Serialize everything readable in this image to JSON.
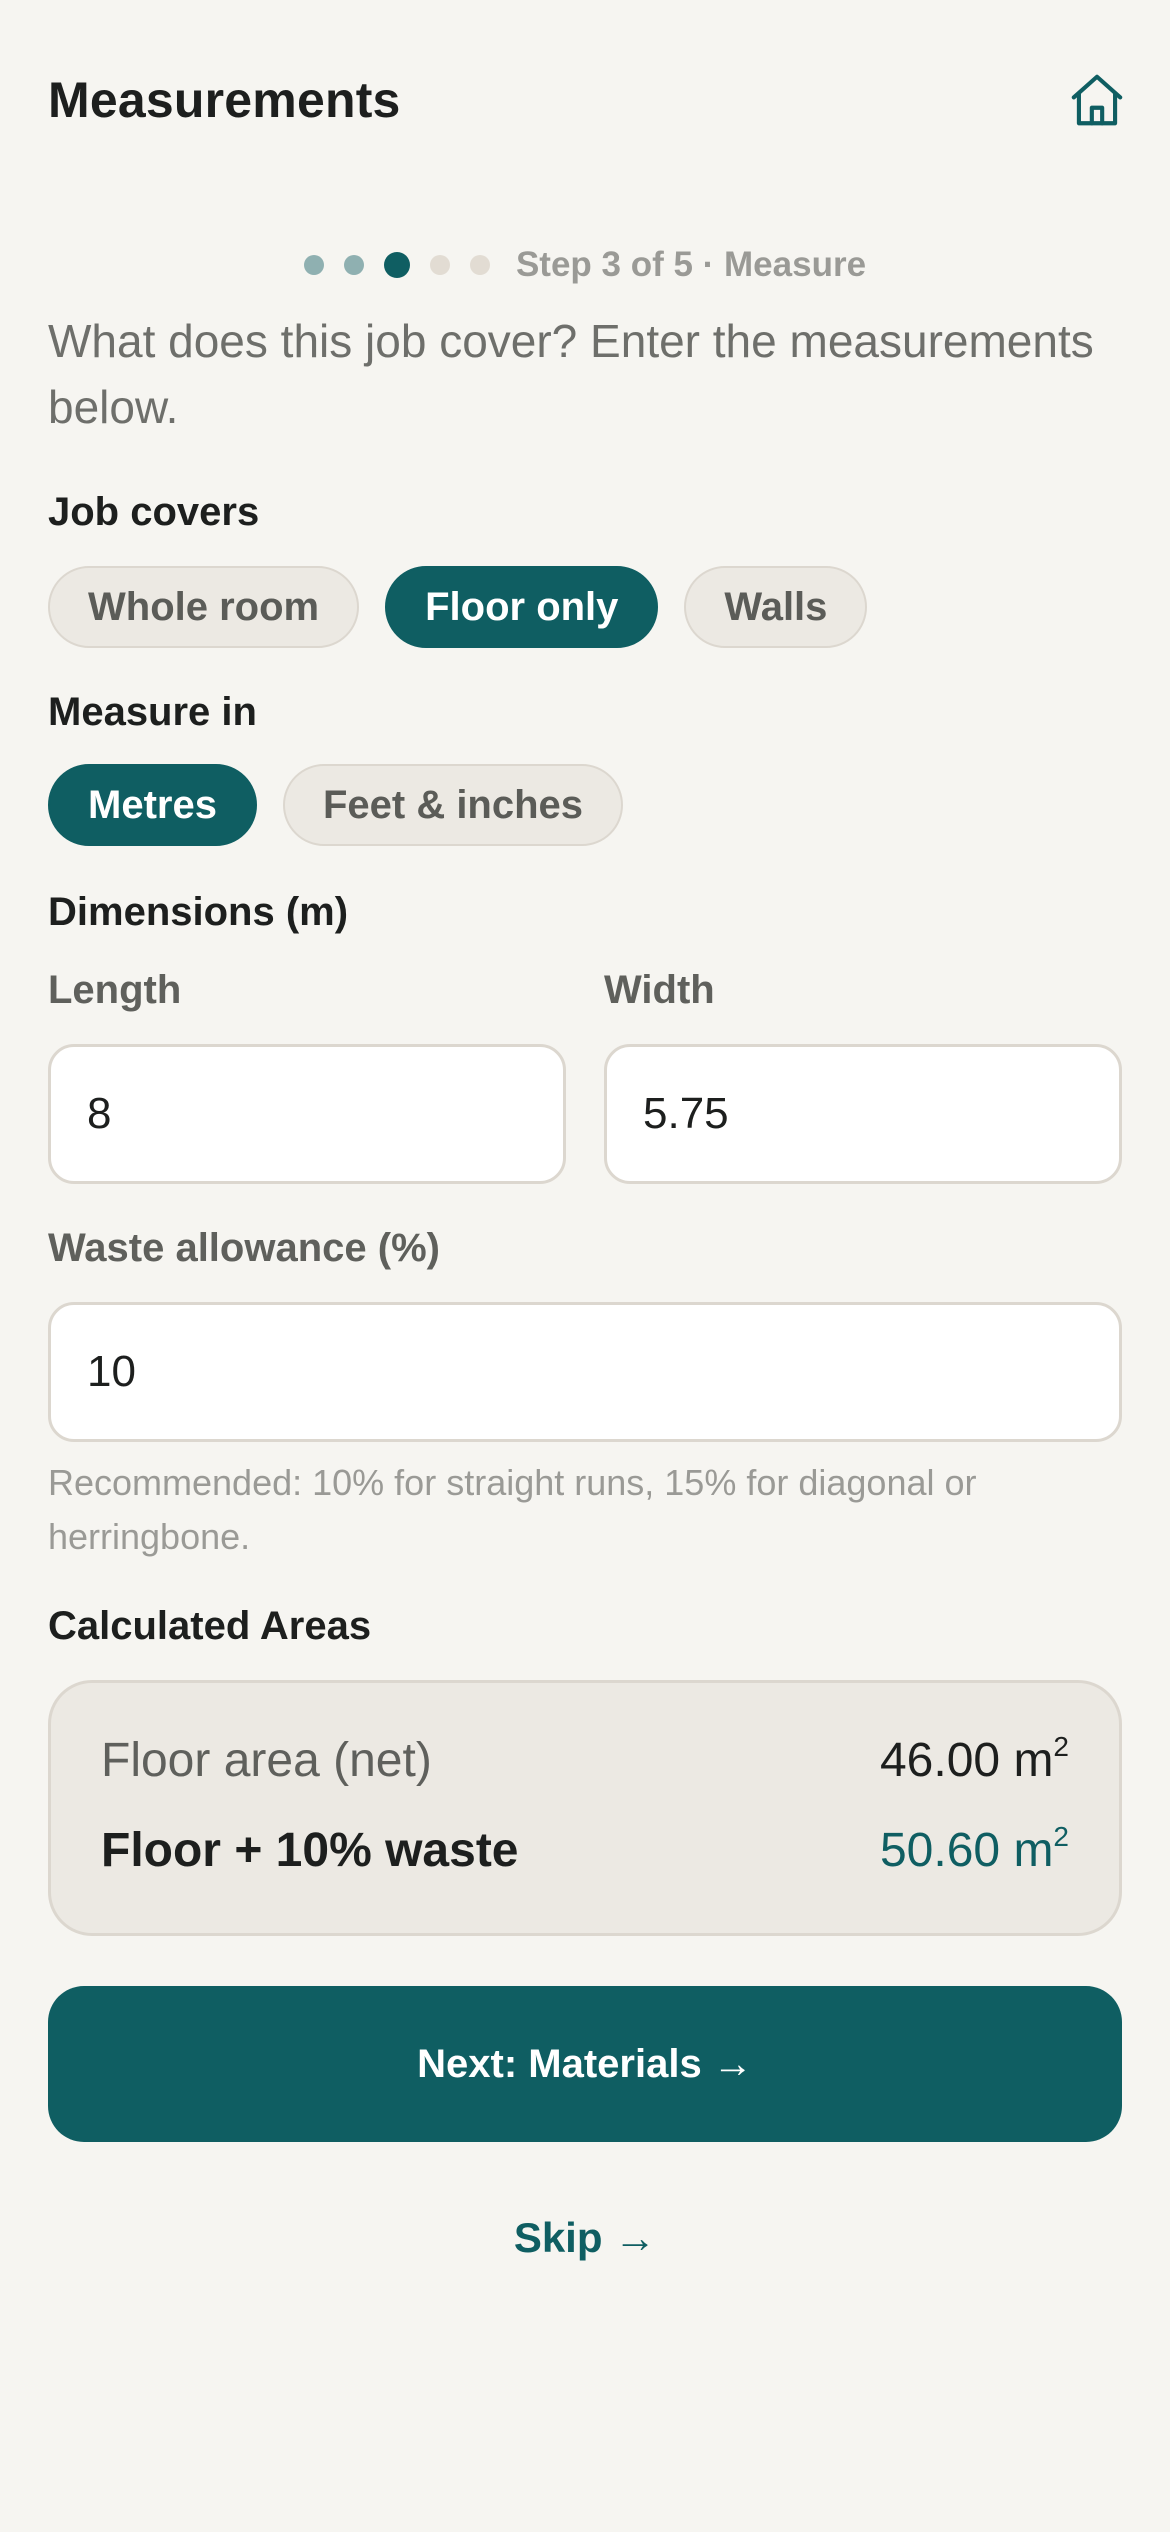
{
  "header": {
    "title": "Measurements",
    "home_icon": "home-icon"
  },
  "stepper": {
    "current": 3,
    "total": 5,
    "label": "Step 3 of 5 · Measure"
  },
  "intro": "What does this job cover? Enter the measurements below.",
  "job_covers": {
    "label": "Job covers",
    "options": [
      "Whole room",
      "Floor only",
      "Walls"
    ],
    "selected": "Floor only"
  },
  "measure_in": {
    "label": "Measure in",
    "options": [
      "Metres",
      "Feet & inches"
    ],
    "selected": "Metres"
  },
  "dimensions": {
    "label": "Dimensions (m)",
    "length_label": "Length",
    "length_value": "8",
    "width_label": "Width",
    "width_value": "5.75"
  },
  "waste": {
    "label": "Waste allowance (%)",
    "value": "10",
    "hint": "Recommended: 10% for straight runs, 15% for diagonal or herringbone."
  },
  "areas": {
    "label": "Calculated Areas",
    "net_label": "Floor area (net)",
    "net_value": "46.00 m",
    "net_unit_sup": "2",
    "waste_label": "Floor + 10% waste",
    "waste_value": "50.60 m",
    "waste_unit_sup": "2"
  },
  "actions": {
    "next_label": "Next: Materials →",
    "skip_label": "Skip →"
  },
  "colors": {
    "accent": "#0f5e62",
    "background": "#f6f5f1",
    "card": "#ece9e3"
  }
}
